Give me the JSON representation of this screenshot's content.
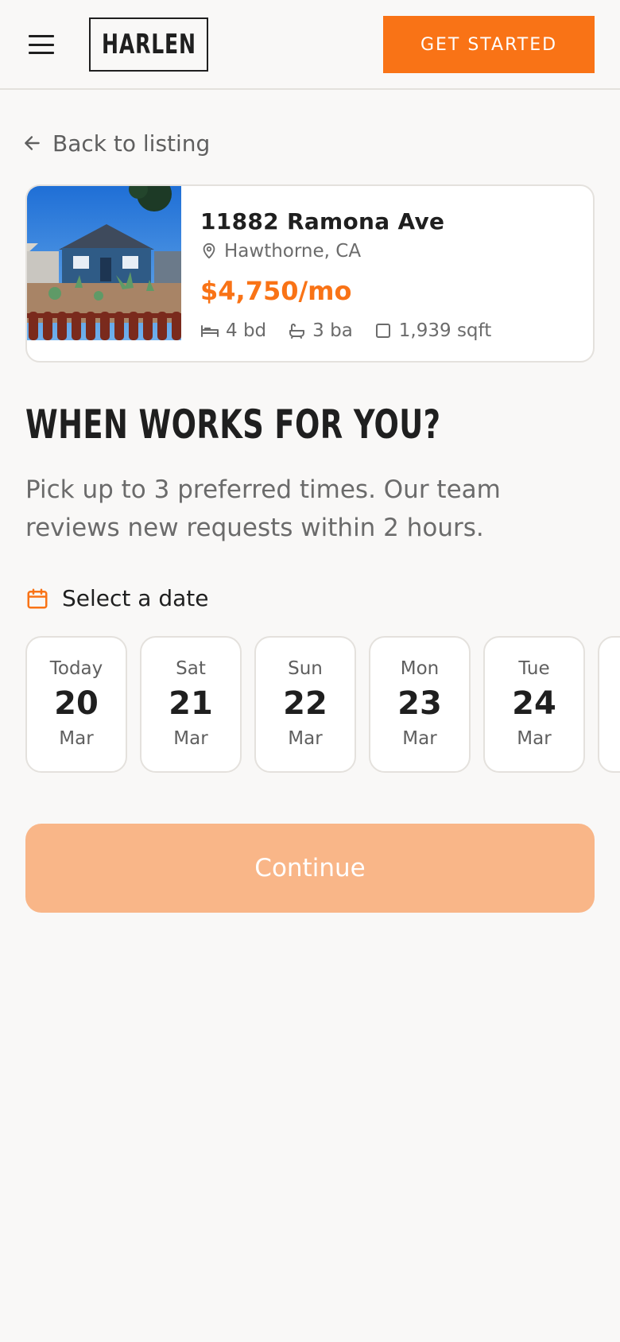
{
  "header": {
    "logo": "HARLEN",
    "cta_label": "GET STARTED"
  },
  "nav": {
    "back_label": "Back to listing"
  },
  "listing": {
    "address": "11882 Ramona Ave",
    "location": "Hawthorne, CA",
    "price": "$4,750/mo",
    "beds": "4 bd",
    "baths": "3 ba",
    "sqft": "1,939 sqft"
  },
  "page": {
    "headline": "WHEN WORKS FOR YOU?",
    "subtext": "Pick up to 3 preferred times. Our team reviews new requests within 2 hours.",
    "select_date_label": "Select a date"
  },
  "dates": [
    {
      "dow": "Today",
      "day": "20",
      "mon": "Mar"
    },
    {
      "dow": "Sat",
      "day": "21",
      "mon": "Mar"
    },
    {
      "dow": "Sun",
      "day": "22",
      "mon": "Mar"
    },
    {
      "dow": "Mon",
      "day": "23",
      "mon": "Mar"
    },
    {
      "dow": "Tue",
      "day": "24",
      "mon": "Mar"
    }
  ],
  "actions": {
    "continue_label": "Continue"
  },
  "colors": {
    "accent": "#f97316",
    "accent_disabled": "#f9b688",
    "background": "#f9f8f7",
    "border": "#e4e1dd"
  },
  "icons": {
    "menu": "hamburger-icon",
    "back": "arrow-left-icon",
    "location": "map-pin-icon",
    "beds": "bed-icon",
    "baths": "bath-icon",
    "sqft": "square-icon",
    "calendar": "calendar-icon"
  }
}
